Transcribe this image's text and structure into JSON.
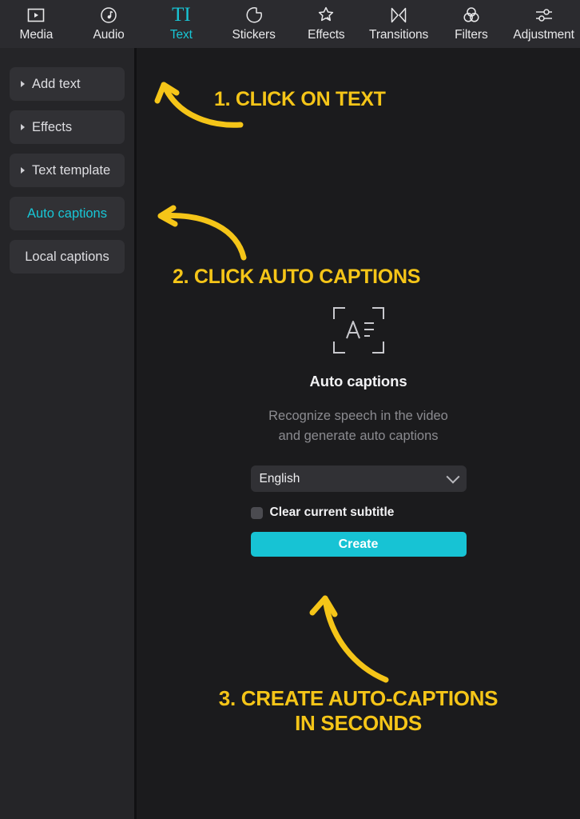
{
  "toolbar": {
    "tabs": [
      {
        "label": "Media",
        "icon": "media-icon",
        "active": false
      },
      {
        "label": "Audio",
        "icon": "audio-icon",
        "active": false
      },
      {
        "label": "Text",
        "icon": "text-icon",
        "active": true
      },
      {
        "label": "Stickers",
        "icon": "stickers-icon",
        "active": false
      },
      {
        "label": "Effects",
        "icon": "effects-icon",
        "active": false
      },
      {
        "label": "Transitions",
        "icon": "transitions-icon",
        "active": false
      },
      {
        "label": "Filters",
        "icon": "filters-icon",
        "active": false
      },
      {
        "label": "Adjustment",
        "icon": "adjustment-icon",
        "active": false
      }
    ],
    "text_tab_glyph": "TI"
  },
  "sidebar": {
    "items": [
      {
        "label": "Add text",
        "expandable": true,
        "active": false
      },
      {
        "label": "Effects",
        "expandable": true,
        "active": false
      },
      {
        "label": "Text template",
        "expandable": true,
        "active": false
      },
      {
        "label": "Auto captions",
        "expandable": false,
        "active": true
      },
      {
        "label": "Local captions",
        "expandable": false,
        "active": false
      }
    ]
  },
  "card": {
    "icon": "auto-captions-frame-icon",
    "icon_letter": "A",
    "title": "Auto captions",
    "description_line1": "Recognize speech in the video",
    "description_line2": "and generate auto captions",
    "language_value": "English",
    "language_options": [
      "English"
    ],
    "clear_subtitle_label": "Clear current subtitle",
    "clear_subtitle_checked": false,
    "create_label": "Create"
  },
  "annotations": {
    "step1": "1. CLICK ON TEXT",
    "step2": "2. CLICK AUTO CAPTIONS",
    "step3_line1": "3. CREATE AUTO-CAPTIONS",
    "step3_line2": "IN SECONDS"
  },
  "colors": {
    "accent_cyan": "#17c3d4",
    "annotation_yellow": "#f5c518",
    "panel_background": "#1b1b1d",
    "sidebar_background": "#252528",
    "toolbar_background": "#2b2b2f"
  }
}
